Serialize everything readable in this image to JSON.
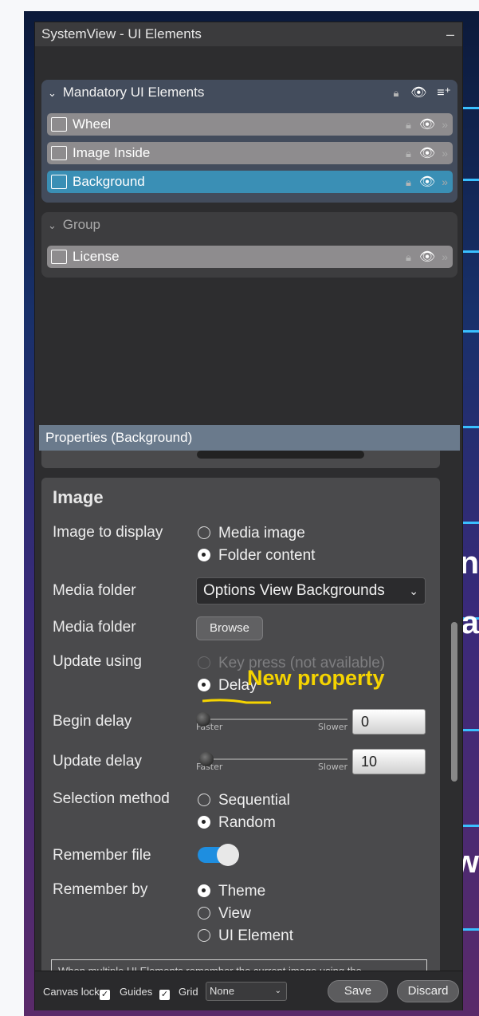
{
  "window": {
    "title": "SystemView - UI Elements",
    "minimize_glyph": "–"
  },
  "background_text": {
    "line1": "n",
    "line2": "a",
    "line3": "w"
  },
  "groups": [
    {
      "label": "Mandatory UI Elements",
      "items": [
        {
          "label": "Wheel",
          "icon": "wheel-icon"
        },
        {
          "label": "Image Inside",
          "icon": "image-icon"
        },
        {
          "label": "Background",
          "icon": "image-icon",
          "selected": true
        }
      ]
    },
    {
      "label": "Group",
      "items": [
        {
          "label": "License",
          "icon": "license-icon"
        }
      ]
    }
  ],
  "properties": {
    "header": "Properties (Background)",
    "section_title": "Image",
    "image_to_display": {
      "label": "Image to display",
      "options": [
        "Media image",
        "Folder content"
      ],
      "selected": "Folder content"
    },
    "media_folder_select": {
      "label": "Media folder",
      "value": "Options View Backgrounds"
    },
    "media_folder_browse": {
      "label": "Media folder",
      "button": "Browse"
    },
    "update_using": {
      "label": "Update using",
      "options": [
        "Key press (not available)",
        "Delay"
      ],
      "selected": "Delay"
    },
    "begin_delay": {
      "label": "Begin delay",
      "faster": "Faster",
      "slower": "Slower",
      "value": "0"
    },
    "update_delay": {
      "label": "Update delay",
      "faster": "Faster",
      "slower": "Slower",
      "value": "10"
    },
    "selection_method": {
      "label": "Selection method",
      "options": [
        "Sequential",
        "Random"
      ],
      "selected": "Random"
    },
    "remember_file": {
      "label": "Remember file",
      "on": true
    },
    "remember_by": {
      "label": "Remember by",
      "options": [
        "Theme",
        "View",
        "UI Element"
      ],
      "selected": "Theme"
    },
    "info_text": "When multiple UI Elements remember the current image using the"
  },
  "annotation": {
    "text": "New property",
    "color": "#f5d400"
  },
  "bottom_bar": {
    "canvas_lock": "Canvas lock",
    "guides": "Guides",
    "grid": "Grid",
    "grid_value": "None",
    "save": "Save",
    "discard": "Discard"
  },
  "colors": {
    "selected_row": "#3a8fb5",
    "toggle_on": "#1e8ee0",
    "accent_annotation": "#f5d400"
  }
}
